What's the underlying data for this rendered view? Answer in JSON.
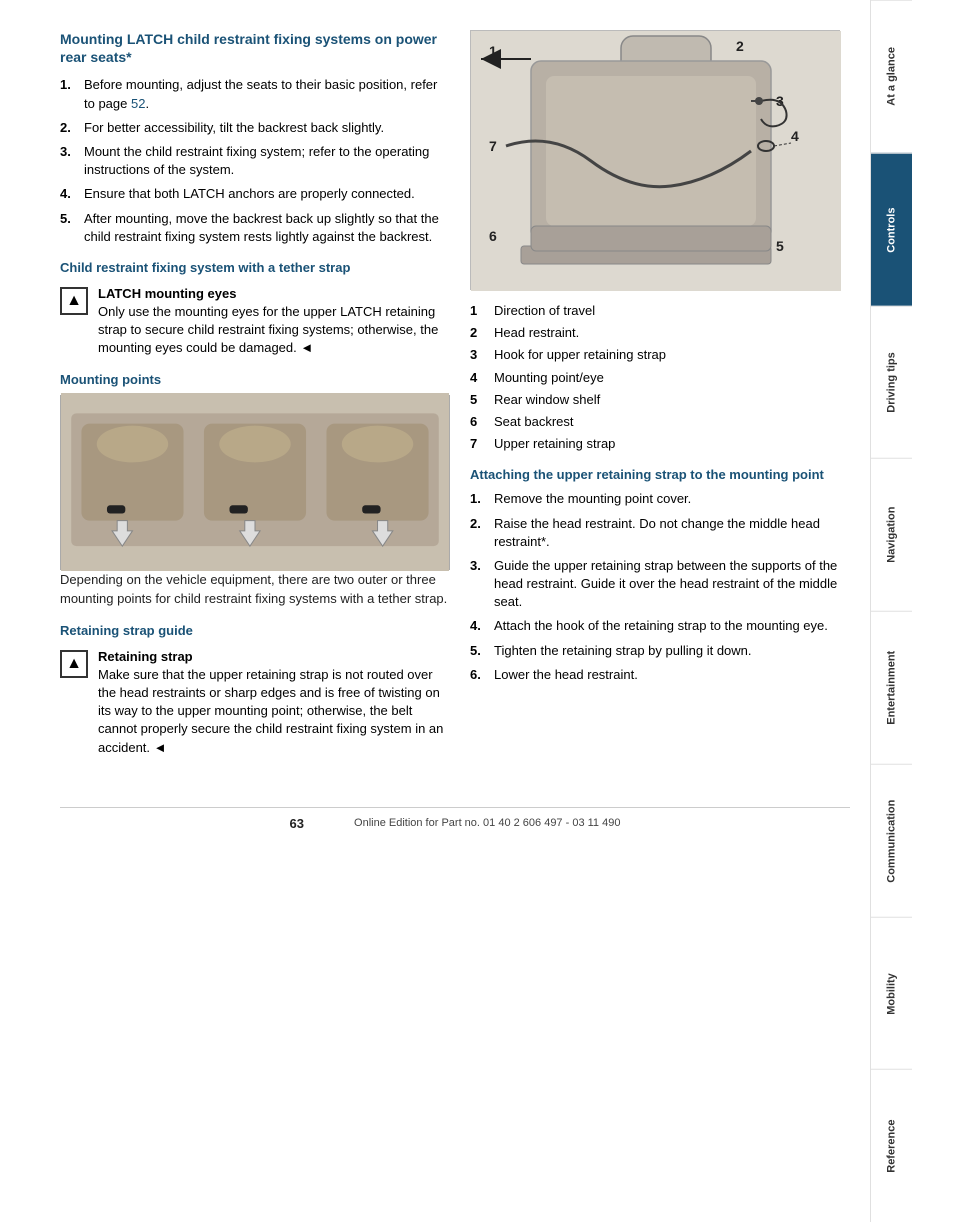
{
  "page": {
    "number": "63",
    "footer_text": "Online Edition for Part no. 01 40 2 606 497 - 03 11 490"
  },
  "sidebar": {
    "items": [
      {
        "label": "At a glance",
        "active": false
      },
      {
        "label": "Controls",
        "active": true
      },
      {
        "label": "Driving tips",
        "active": false
      },
      {
        "label": "Navigation",
        "active": false
      },
      {
        "label": "Entertainment",
        "active": false
      },
      {
        "label": "Communication",
        "active": false
      },
      {
        "label": "Mobility",
        "active": false
      },
      {
        "label": "Reference",
        "active": false
      }
    ]
  },
  "left_column": {
    "main_title": "Mounting LATCH child restraint fixing systems on power rear seats*",
    "steps": [
      {
        "num": "1.",
        "text": "Before mounting, adjust the seats to their basic position, refer to page 52."
      },
      {
        "num": "2.",
        "text": "For better accessibility, tilt the backrest back slightly."
      },
      {
        "num": "3.",
        "text": "Mount the child restraint fixing system; refer to the operating instructions of the system."
      },
      {
        "num": "4.",
        "text": "Ensure that both LATCH anchors are properly connected."
      },
      {
        "num": "5.",
        "text": "After mounting, move the backrest back up slightly so that the child restraint fixing system rests lightly against the backrest."
      }
    ],
    "child_section_title": "Child restraint fixing system with a tether strap",
    "warning1_label": "LATCH mounting eyes",
    "warning1_text": "Only use the mounting eyes for the upper LATCH retaining strap to secure child restraint fixing systems; otherwise, the mounting eyes could be damaged.",
    "warning1_end": "◄",
    "mounting_points_title": "Mounting points",
    "caption": "Depending on the vehicle equipment, there are two outer or three mounting points for child restraint fixing systems with a tether strap.",
    "retaining_strap_title": "Retaining strap guide",
    "warning2_label": "Retaining strap",
    "warning2_text": "Make sure that the upper retaining strap is not routed over the head restraints or sharp edges and is free of twisting on its way to the upper mounting point; otherwise, the belt cannot properly secure the child restraint fixing system in an accident.",
    "warning2_end": "◄"
  },
  "right_column": {
    "diagram_labels": [
      {
        "num": "1",
        "text": "Direction of travel"
      },
      {
        "num": "2",
        "text": "Head restraint."
      },
      {
        "num": "3",
        "text": "Hook for upper retaining strap"
      },
      {
        "num": "4",
        "text": "Mounting point/eye"
      },
      {
        "num": "5",
        "text": "Rear window shelf"
      },
      {
        "num": "6",
        "text": "Seat backrest"
      },
      {
        "num": "7",
        "text": "Upper retaining strap"
      }
    ],
    "attaching_title": "Attaching the upper retaining strap to the mounting point",
    "attaching_steps": [
      {
        "num": "1.",
        "text": "Remove the mounting point cover."
      },
      {
        "num": "2.",
        "text": "Raise the head restraint. Do not change the middle head restraint*."
      },
      {
        "num": "3.",
        "text": "Guide the upper retaining strap between the supports of the head restraint. Guide it over the head restraint of the middle seat."
      },
      {
        "num": "4.",
        "text": "Attach the hook of the retaining strap to the mounting eye."
      },
      {
        "num": "5.",
        "text": "Tighten the retaining strap by pulling it down."
      },
      {
        "num": "6.",
        "text": "Lower the head restraint."
      }
    ]
  }
}
